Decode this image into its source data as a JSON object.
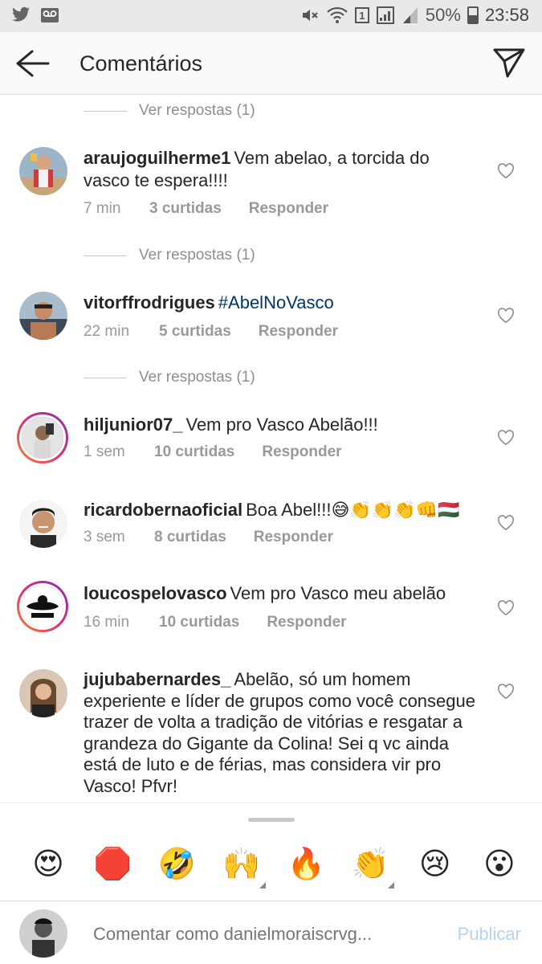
{
  "status_bar": {
    "battery": "50%",
    "time": "23:58",
    "sim_slot": "1",
    "icons_left": [
      "twitter-icon",
      "voicemail-icon"
    ],
    "icons_right": [
      "mute-icon",
      "wifi-icon",
      "sim-badge",
      "signal-icon",
      "signal-icon",
      "battery-icon"
    ]
  },
  "header": {
    "title": "Comentários",
    "back_icon": "arrow-left-icon",
    "send_icon": "paper-plane-icon"
  },
  "replies_label": "Ver respostas (1)",
  "comments": [
    {
      "username": "araujoguilherme1",
      "text": "Vem abelao, a torcida do vasco te espera!!!!",
      "time": "7 min",
      "likes": "3 curtidas",
      "reply": "Responder"
    },
    {
      "username": "vitorffrodrigues",
      "text": "#AbelNoVasco",
      "time": "22 min",
      "likes": "5 curtidas",
      "reply": "Responder"
    },
    {
      "username": "hiljunior07_",
      "text": "Vem pro Vasco Abelão!!!",
      "time": "1 sem",
      "likes": "10 curtidas",
      "reply": "Responder"
    },
    {
      "username": "ricardobernaoficial",
      "text": "Boa Abel!!!😅👏👏👏👊🇭🇺",
      "time": "3 sem",
      "likes": "8 curtidas",
      "reply": "Responder"
    },
    {
      "username": "loucospelovasco",
      "text": "Vem pro Vasco meu abelão",
      "time": "16 min",
      "likes": "10 curtidas",
      "reply": "Responder"
    },
    {
      "username": "jujubabernardes_",
      "text": "Abelão, só um homem experiente e líder de grupos como você consegue trazer de volta a tradição de vitórias e resgatar a grandeza do Gigante da Colina! Sei q vc ainda está de luto e de férias, mas considera vir pro Vasco! Pfvr!",
      "time": "",
      "likes": "",
      "reply": ""
    }
  ],
  "emoji_bar": [
    "😍",
    "🛑",
    "🤣",
    "🙌",
    "🔥",
    "👏",
    "😢",
    "😮"
  ],
  "compose": {
    "placeholder": "Comentar como danielmoraiscrvg...",
    "publish_label": "Publicar"
  },
  "colors": {
    "hashtag": "#003569",
    "publish_disabled": "#b3d3f5",
    "meta_text": "#999999",
    "story_ring": "#dd2a7b"
  }
}
